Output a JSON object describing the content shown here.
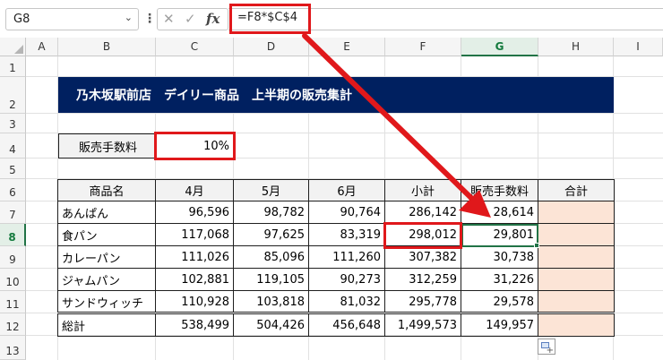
{
  "formula_bar": {
    "name_box": "G8",
    "name_box_chevron": "⌄",
    "more_icon": "⋮",
    "cancel_icon": "✕",
    "enter_icon": "✓",
    "fx_icon": "fx",
    "formula": "=F8*$C$4"
  },
  "columns": [
    "A",
    "B",
    "C",
    "D",
    "E",
    "F",
    "G",
    "H",
    "I"
  ],
  "rows": [
    "1",
    "2",
    "3",
    "4",
    "5",
    "6",
    "7",
    "8",
    "9",
    "10",
    "11",
    "12",
    "13"
  ],
  "sheet": {
    "title": "乃木坂駅前店　デイリー商品　上半期の販売集計",
    "fee_label": "販売手数料",
    "fee_value": "10%",
    "headers": [
      "商品名",
      "4月",
      "5月",
      "6月",
      "小計",
      "販売手数料",
      "合計"
    ],
    "data": [
      [
        "あんぱん",
        "96,596",
        "98,782",
        "90,764",
        "286,142",
        "28,614",
        ""
      ],
      [
        "食パン",
        "117,068",
        "97,625",
        "83,319",
        "298,012",
        "29,801",
        ""
      ],
      [
        "カレーパン",
        "111,026",
        "85,096",
        "111,260",
        "307,382",
        "30,738",
        ""
      ],
      [
        "ジャムパン",
        "102,881",
        "119,105",
        "90,273",
        "312,259",
        "31,226",
        ""
      ],
      [
        "サンドウィッチ",
        "110,928",
        "103,818",
        "81,032",
        "295,778",
        "29,578",
        ""
      ],
      [
        "総計",
        "538,499",
        "504,426",
        "456,648",
        "1,499,573",
        "149,957",
        ""
      ]
    ]
  },
  "colors": {
    "banner": "#002060",
    "highlight": "#e0181b",
    "selection": "#217346",
    "total_fill": "#fce4d6"
  },
  "icons": {
    "quick_analysis": "quick-analysis-icon"
  }
}
